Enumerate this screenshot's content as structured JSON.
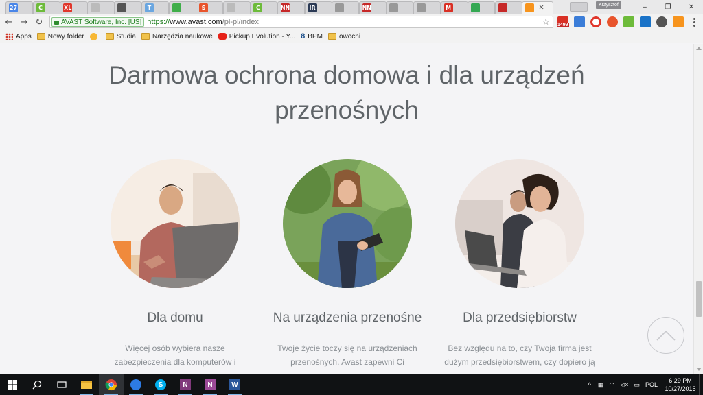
{
  "browser": {
    "tabs": [
      {
        "favicon": "google-calendar-icon",
        "label": "27",
        "color": "#4a86e8"
      },
      {
        "favicon": "c-green-icon",
        "label": "C",
        "color": "#6dbb3a"
      },
      {
        "favicon": "xl-icon",
        "label": "XL",
        "color": "#e0362b"
      },
      {
        "favicon": "wiki-icon",
        "label": "",
        "color": "#bbbbbb"
      },
      {
        "favicon": "stats-icon",
        "label": "",
        "color": "#555555"
      },
      {
        "favicon": "t-icon",
        "label": "T",
        "color": "#6aa6e0"
      },
      {
        "favicon": "wifi-icon",
        "label": "",
        "color": "#3fae49"
      },
      {
        "favicon": "s-icon",
        "label": "S",
        "color": "#e8542c"
      },
      {
        "favicon": "wiki-icon",
        "label": "",
        "color": "#bbbbbb"
      },
      {
        "favicon": "c-green-icon",
        "label": "C",
        "color": "#6dbb3a"
      },
      {
        "favicon": "nn-icon",
        "label": "NN",
        "color": "#c62828"
      },
      {
        "favicon": "ir-icon",
        "label": "IR",
        "color": "#2b3a55"
      },
      {
        "favicon": "feather-icon",
        "label": "",
        "color": "#999999"
      },
      {
        "favicon": "nn-icon",
        "label": "NN",
        "color": "#c62828"
      },
      {
        "favicon": "feather-icon",
        "label": "",
        "color": "#999999"
      },
      {
        "favicon": "feather-icon",
        "label": "",
        "color": "#999999"
      },
      {
        "favicon": "gmail-icon",
        "label": "M",
        "color": "#d93025"
      },
      {
        "favicon": "adwords-icon",
        "label": "",
        "color": "#34a853"
      },
      {
        "favicon": "shield-icon",
        "label": "",
        "color": "#c62828"
      },
      {
        "favicon": "avast-icon",
        "label": "",
        "color": "#f7941d"
      }
    ],
    "profile_name": "Krzysztof",
    "window_controls": {
      "minimize": "–",
      "restore": "❐",
      "close": "✕"
    },
    "ev_certificate": "AVAST Software, Inc. [US]",
    "url": {
      "scheme": "https://",
      "host": "www.avast.com",
      "path": "/pl-pl/index"
    },
    "extension_badge": "1499",
    "bookmarks": [
      {
        "label": "Apps",
        "icon": "apps-grid-icon"
      },
      {
        "label": "Nowy folder",
        "icon": "folder-icon"
      },
      {
        "label": "",
        "icon": "face-icon"
      },
      {
        "label": "Studia",
        "icon": "folder-icon"
      },
      {
        "label": "Narzędzia naukowe",
        "icon": "folder-icon"
      },
      {
        "label": "Pickup Evolution - Y...",
        "icon": "youtube-icon"
      },
      {
        "label": "BPM",
        "icon": "eight-icon"
      },
      {
        "label": "owocni",
        "icon": "folder-icon"
      }
    ]
  },
  "page": {
    "headline_line1": "Darmowa ochrona domowa i dla urządzeń",
    "headline_line2": "przenośnych",
    "cards": [
      {
        "title": "Dla domu",
        "text": "Więcej osób wybiera nasze zabezpieczenia dla komputerów i"
      },
      {
        "title": "Na urządzenia przenośne",
        "text": "Twoje życie toczy się na urządzeniach przenośnych. Avast zapewni Ci"
      },
      {
        "title": "Dla przedsiębiorstw",
        "text": "Bez względu na to, czy Twoja firma jest dużym przedsiębiorstwem, czy dopiero ją"
      }
    ]
  },
  "taskbar": {
    "apps": [
      "start-icon",
      "search-icon",
      "task-view-icon",
      "file-explorer-icon",
      "chrome-icon",
      "outlook-icon",
      "skype-icon",
      "onenote-icon",
      "onenote-2-icon",
      "word-icon"
    ],
    "language": "POL",
    "time": "6:29 PM",
    "date": "10/27/2015"
  }
}
